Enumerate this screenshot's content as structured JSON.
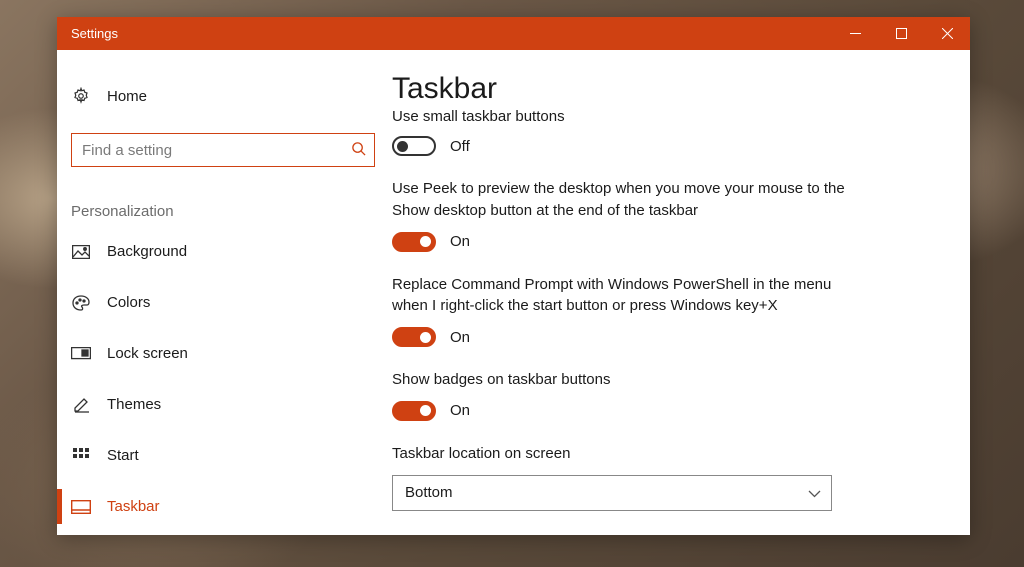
{
  "window": {
    "title": "Settings"
  },
  "sidebar": {
    "home_label": "Home",
    "search_placeholder": "Find a setting",
    "category": "Personalization",
    "items": [
      {
        "label": "Background"
      },
      {
        "label": "Colors"
      },
      {
        "label": "Lock screen"
      },
      {
        "label": "Themes"
      },
      {
        "label": "Start"
      },
      {
        "label": "Taskbar"
      }
    ]
  },
  "main": {
    "title": "Taskbar",
    "settings": [
      {
        "label": "Use small taskbar buttons",
        "enabled": false,
        "state": "Off"
      },
      {
        "label": "Use Peek to preview the desktop when you move your mouse to the Show desktop button at the end of the taskbar",
        "enabled": true,
        "state": "On"
      },
      {
        "label": "Replace Command Prompt with Windows PowerShell in the menu when I right-click the start button or press Windows key+X",
        "enabled": true,
        "state": "On"
      },
      {
        "label": "Show badges on taskbar buttons",
        "enabled": true,
        "state": "On"
      }
    ],
    "location_label": "Taskbar location on screen",
    "location_value": "Bottom"
  }
}
